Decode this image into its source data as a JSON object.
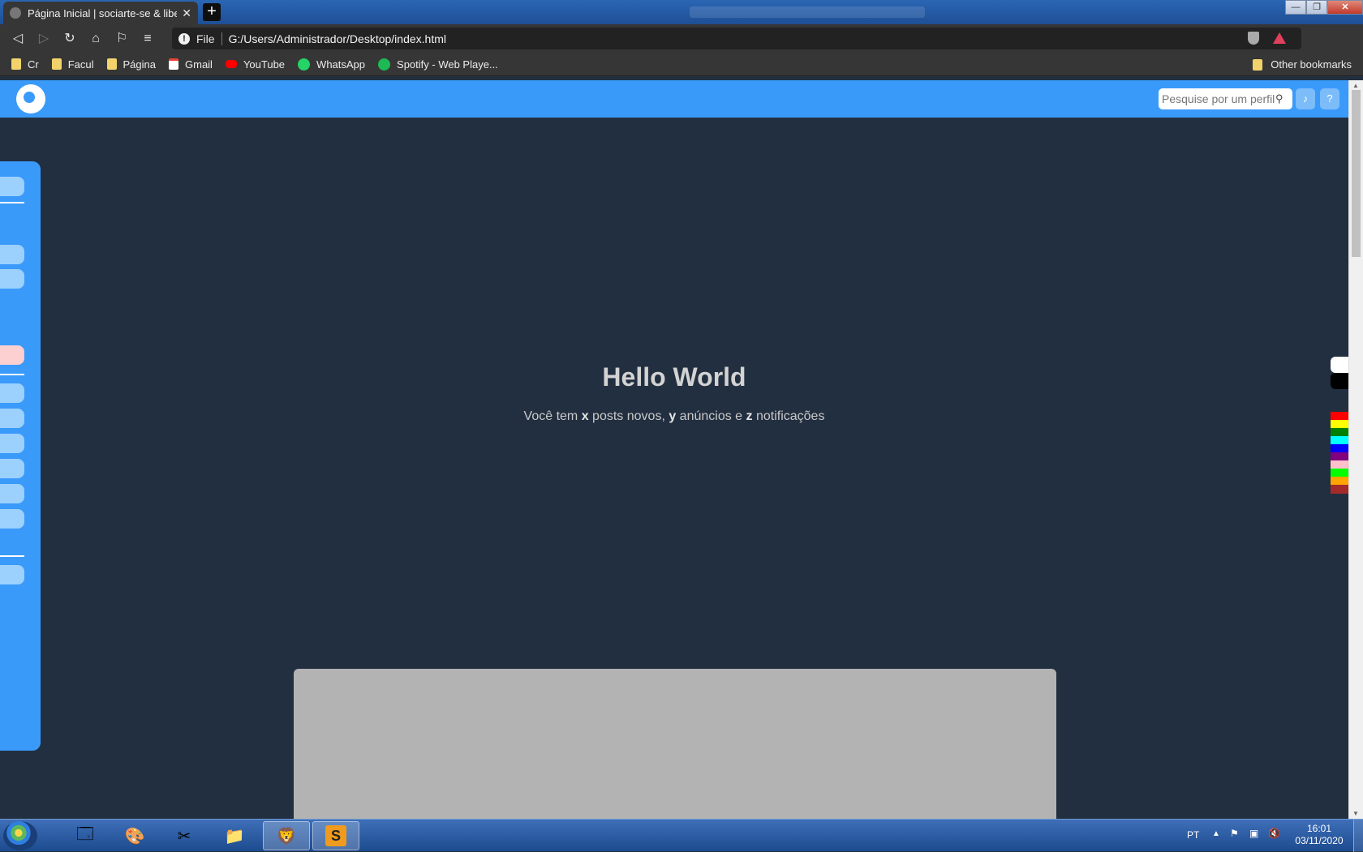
{
  "browser": {
    "tab_title": "Página Inicial | sociarte-se & liber",
    "tab_close": "✕",
    "new_tab": "+",
    "url_scheme": "File",
    "url": "G:/Users/Administrador/Desktop/index.html",
    "bookmarks": [
      {
        "label": "Cr",
        "icon": "folder-icon"
      },
      {
        "label": "Facul",
        "icon": "folder-icon"
      },
      {
        "label": "Página",
        "icon": "folder-icon"
      },
      {
        "label": "Gmail",
        "icon": "gmail-icon"
      },
      {
        "label": "YouTube",
        "icon": "youtube-icon"
      },
      {
        "label": "WhatsApp",
        "icon": "whatsapp-icon"
      },
      {
        "label": "Spotify - Web Playe...",
        "icon": "spotify-icon"
      }
    ],
    "other_bookmarks": "Other bookmarks"
  },
  "site": {
    "search_placeholder": "Pesquise por um perfil",
    "accent": "#3a9afa",
    "hero": {
      "title": "Hello World",
      "sub_1": "Você tem ",
      "x": "x",
      "sub_2": " posts novos, ",
      "y": "y",
      "sub_3": " anúncios e ",
      "z": "z",
      "sub_4": " notificações"
    },
    "theme_swatches": [
      "#ffffff",
      "#000000"
    ],
    "color_swatches": [
      "#ff0000",
      "#ffff00",
      "#008000",
      "#00ffff",
      "#0000ff",
      "#800080",
      "#ffc0cb",
      "#00ff00",
      "#ffa500",
      "#a52a2a"
    ]
  },
  "taskbar": {
    "language": "PT",
    "time": "16:01",
    "date": "03/11/2020"
  }
}
